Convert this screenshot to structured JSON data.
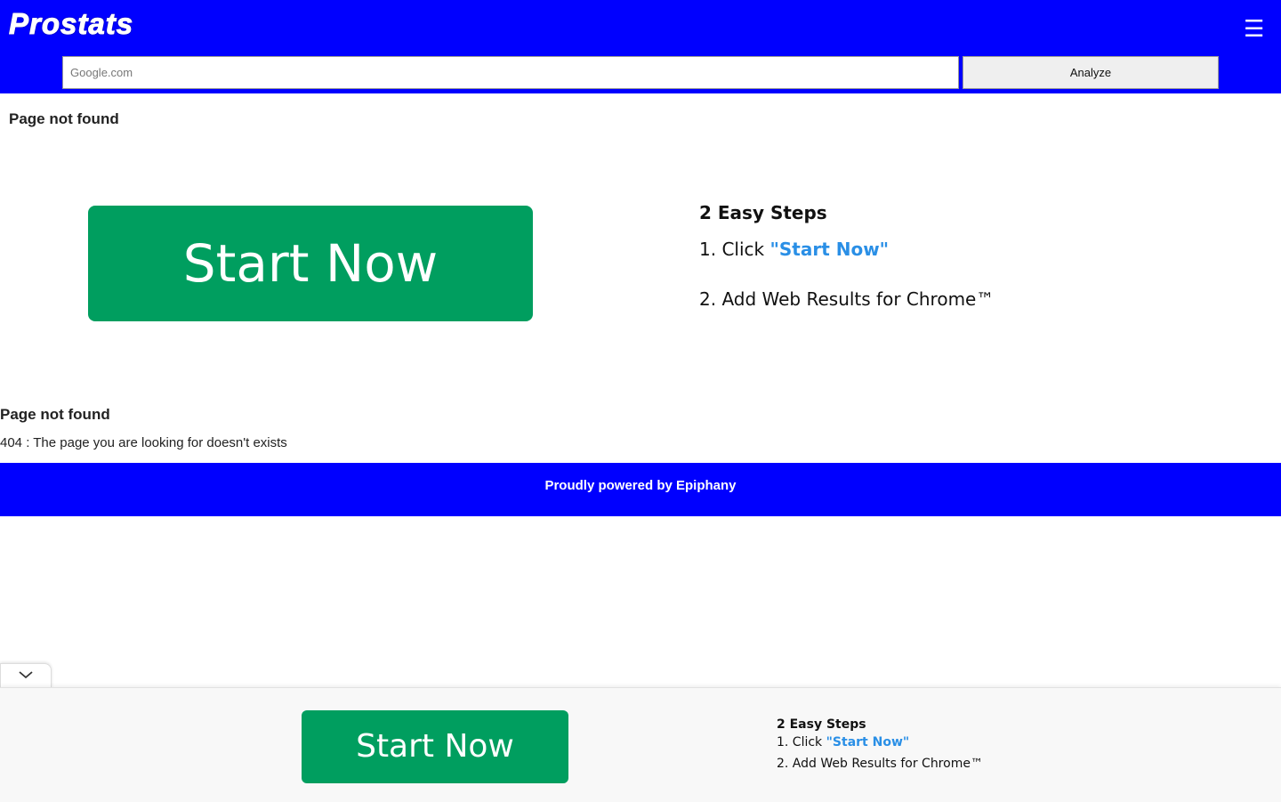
{
  "header": {
    "logo": "Prostats",
    "menu_icon": "hamburger-menu-icon",
    "background": "#0000ff"
  },
  "search": {
    "placeholder": "Google.com",
    "value": "",
    "button_label": "Analyze"
  },
  "main": {
    "title_top": "Page not found",
    "start_button": "Start Now",
    "steps_title": "2 Easy Steps",
    "step1_prefix": "1. Click ",
    "step1_link": "\"Start Now\"",
    "step2": "2. Add Web Results for Chrome™",
    "title_bottom": "Page not found",
    "description": "404 : The page you are looking for doesn't exists",
    "accent_green": "#009e5f",
    "link_blue": "#2a8fe6"
  },
  "footer": {
    "text": "Proudly powered by Epiphany"
  },
  "ad_bar": {
    "collapse_icon": "chevron-down-icon",
    "start_button": "Start Now",
    "steps_title": "2 Easy Steps",
    "step1_prefix": "1. Click ",
    "step1_link": "\"Start Now\"",
    "step2": "2. Add Web Results for Chrome™"
  }
}
